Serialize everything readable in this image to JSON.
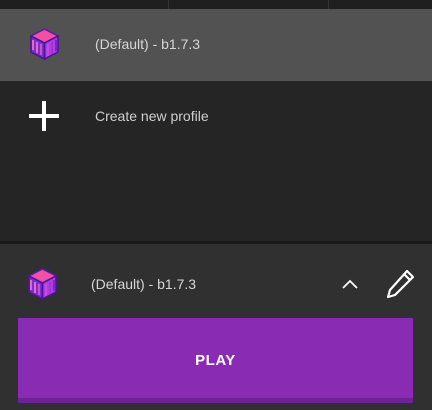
{
  "profiles": {
    "items": [
      {
        "label": "(Default) - b1.7.3",
        "icon": "grass-block-icon",
        "selected": true
      }
    ],
    "create_label": "Create new profile",
    "create_icon": "plus-icon"
  },
  "current_profile": {
    "label": "(Default) - b1.7.3",
    "icon": "grass-block-icon",
    "expand_icon": "chevron-up-icon",
    "edit_icon": "pencil-icon"
  },
  "play": {
    "label": "PLAY"
  },
  "colors": {
    "accent": "#8a2cb3",
    "selected_row": "#525252",
    "background": "#242424",
    "panel": "#303030"
  }
}
